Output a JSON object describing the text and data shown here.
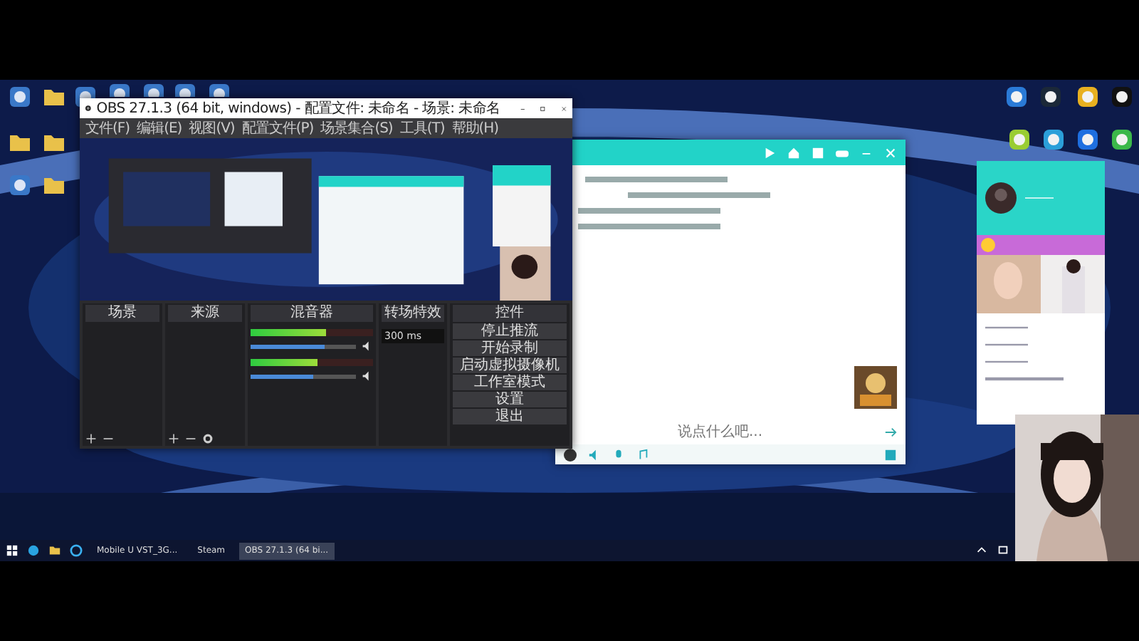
{
  "obs": {
    "title": "OBS 27.1.3 (64 bit, windows) - 配置文件: 未命名 - 场景: 未命名",
    "menu": [
      "文件(F)",
      "编辑(E)",
      "视图(V)",
      "配置文件(P)",
      "场景集合(S)",
      "工具(T)",
      "帮助(H)"
    ],
    "docks": [
      "场景",
      "来源",
      "混音器",
      "转场特效",
      "控件"
    ],
    "mixer": [
      {
        "meter": {
          "level": 0.62
        },
        "volume": {
          "level": 0.7
        }
      },
      {
        "meter": {
          "level": 0.55
        },
        "volume": {
          "level": 0.6
        }
      }
    ],
    "transition": {
      "duration": "300 ms"
    },
    "controls": [
      "停止推流",
      "开始录制",
      "启动虚拟摄像机",
      "工作室模式",
      "设置",
      "退出"
    ]
  },
  "chat": {
    "input": {
      "placeholder": "说点什么吧..."
    }
  },
  "taskbar": {
    "items": [
      {
        "label": "Mobile U VST_3G...",
        "selected": false
      },
      {
        "label": "Steam",
        "selected": false
      },
      {
        "label": "OBS 27.1.3 (64 bi...",
        "selected": true
      }
    ]
  }
}
